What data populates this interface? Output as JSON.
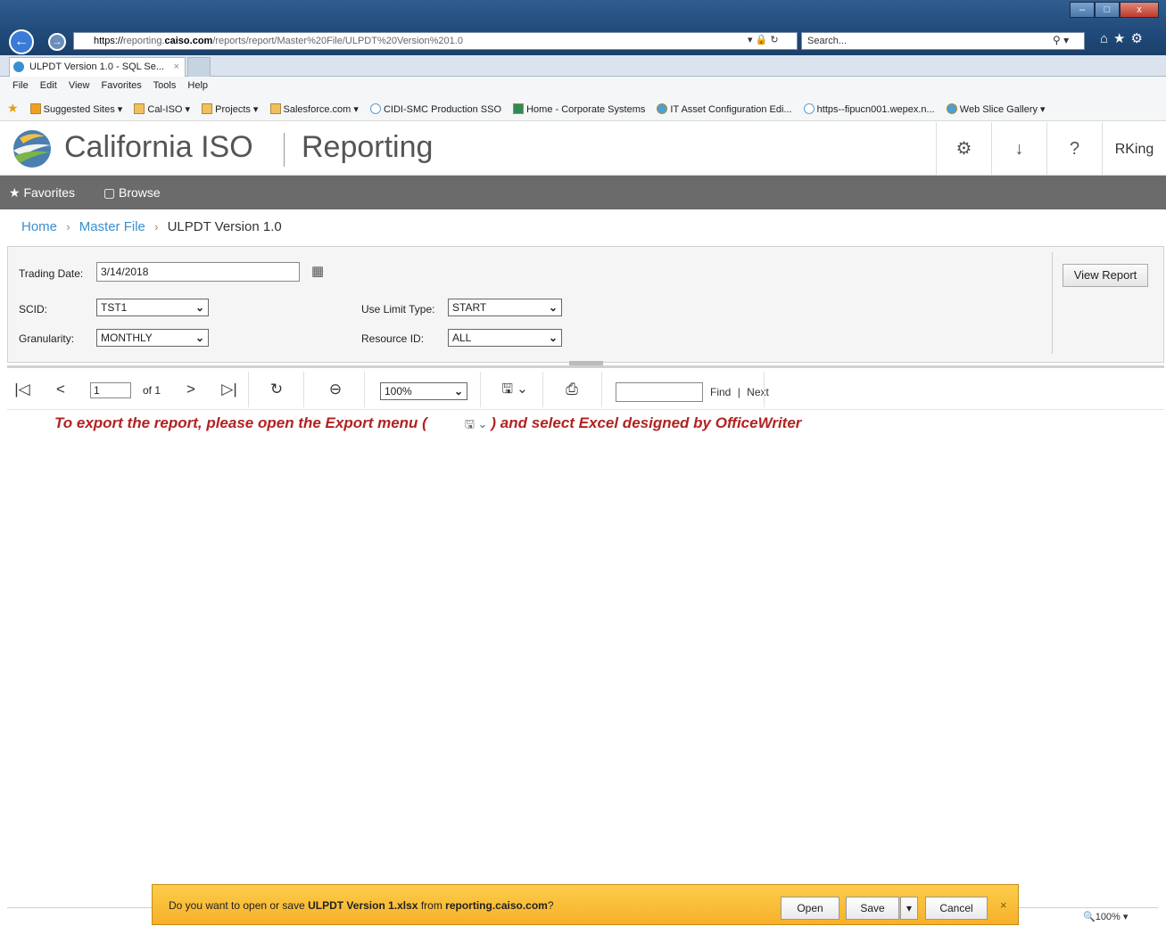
{
  "browser": {
    "url_scheme": "https://",
    "url_host_prefix": "reporting.",
    "url_host": "caiso.com",
    "url_path": "/reports/report/Master%20File/ULPDT%20Version%201.0",
    "address_controls": "▾ 🔒 ↻",
    "search_placeholder": "Search...",
    "tab_title": "ULPDT Version 1.0 - SQL Se...",
    "tab_close": "×",
    "menu": [
      "File",
      "Edit",
      "View",
      "Favorites",
      "Tools",
      "Help"
    ],
    "favorites": [
      {
        "label": "Suggested Sites ▾",
        "icon": "b"
      },
      {
        "label": "Cal-ISO ▾",
        "icon": ""
      },
      {
        "label": "Projects ▾",
        "icon": ""
      },
      {
        "label": "Salesforce.com ▾",
        "icon": ""
      },
      {
        "label": "CIDI-SMC Production SSO",
        "icon": "c"
      },
      {
        "label": "Home - Corporate Systems",
        "icon": "t"
      },
      {
        "label": "IT Asset Configuration Edi...",
        "icon": "g"
      },
      {
        "label": "https--fipucn001.wepex.n...",
        "icon": "c"
      },
      {
        "label": "Web Slice Gallery ▾",
        "icon": "g"
      }
    ],
    "window_buttons": [
      "–",
      "□",
      "x"
    ],
    "toolbar_icons": "⌂★⚙"
  },
  "app": {
    "brand": "California ISO",
    "product": "Reporting",
    "settings_icon": "⚙",
    "download_icon": "↓",
    "help_icon": "?",
    "user": "RKing"
  },
  "subnav": {
    "favorites": "★ Favorites",
    "browse": "▢ Browse"
  },
  "breadcrumb": {
    "home": "Home",
    "master": "Master File",
    "current": "ULPDT Version 1.0",
    "sep": "›"
  },
  "params": {
    "trading_date_label": "Trading Date:",
    "trading_date_value": "3/14/2018",
    "scid_label": "SCID:",
    "scid_value": "TST1",
    "granularity_label": "Granularity:",
    "granularity_value": "MONTHLY",
    "use_limit_label": "Use Limit Type:",
    "use_limit_value": "START",
    "resource_label": "Resource ID:",
    "resource_value": "ALL",
    "view_report": "View Report"
  },
  "toolbar": {
    "first": "|◁",
    "prev": "<",
    "page": "1",
    "of": "of 1",
    "next": ">",
    "last": "▷|",
    "refresh": "↻",
    "back": "⊖",
    "zoom": "100%",
    "export": "🖫 ⌄",
    "print": "⎙",
    "find": "Find",
    "find_sep": "|",
    "next_find": "Next"
  },
  "instruction": {
    "part1": "To export the report, please open the Export menu (",
    "icon": "🖫 ⌄",
    "part2": ") and select Excel designed by OfficeWriter"
  },
  "notification": {
    "prefix": "Do you want to open or save ",
    "file": "ULPDT Version 1.xlsx",
    "middle": " from ",
    "site": "reporting.caiso.com",
    "suffix": "?",
    "open": "Open",
    "save": "Save",
    "save_menu": "▾",
    "cancel": "Cancel",
    "close": "×"
  },
  "status": {
    "zoom": "🔍100%  ▾"
  }
}
